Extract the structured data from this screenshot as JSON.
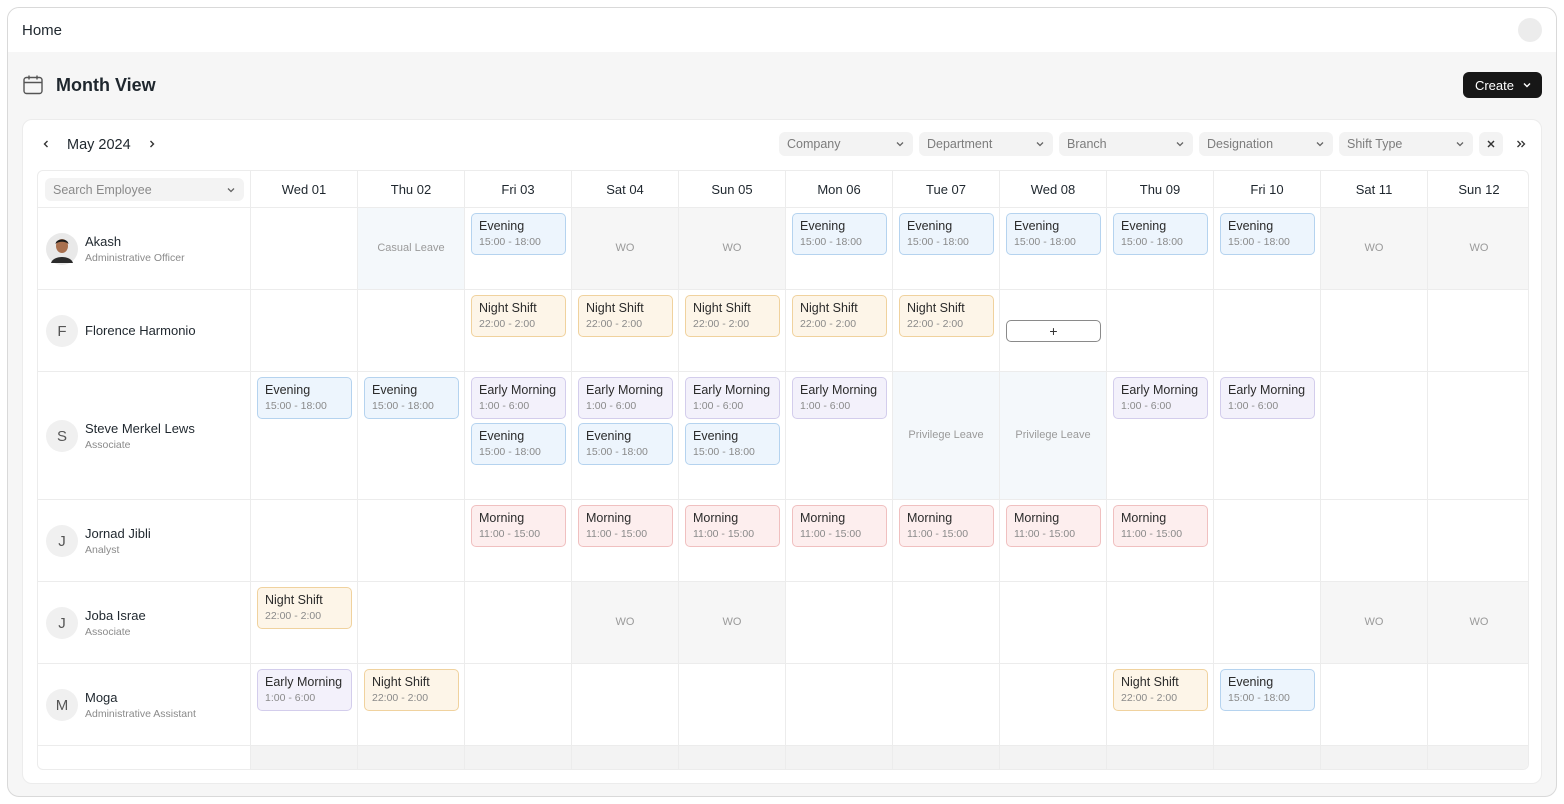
{
  "topbar": {
    "breadcrumb": "Home"
  },
  "page": {
    "title": "Month View",
    "create_label": "Create"
  },
  "toolbar": {
    "month_label": "May 2024",
    "filters": [
      "Company",
      "Department",
      "Branch",
      "Designation",
      "Shift Type"
    ]
  },
  "search": {
    "placeholder": "Search Employee"
  },
  "days": [
    "Wed 01",
    "Thu 02",
    "Fri 03",
    "Sat 04",
    "Sun 05",
    "Mon 06",
    "Tue 07",
    "Wed 08",
    "Thu 09",
    "Fri 10",
    "Sat 11",
    "Sun 12"
  ],
  "shift_types": {
    "evening": {
      "name": "Evening",
      "time": "15:00 - 18:00"
    },
    "night": {
      "name": "Night Shift",
      "time": "22:00 - 2:00"
    },
    "early": {
      "name": "Early Morning",
      "time": "1:00 - 6:00"
    },
    "morning": {
      "name": "Morning",
      "time": "11:00 - 15:00"
    }
  },
  "employees": [
    {
      "name": "Akash",
      "role": "Administrative Officer",
      "initial": "",
      "photo": true,
      "cells": [
        {},
        {
          "leave": "Casual Leave"
        },
        {
          "shifts": [
            "evening"
          ]
        },
        {
          "wo": "WO"
        },
        {
          "wo": "WO"
        },
        {
          "shifts": [
            "evening"
          ]
        },
        {
          "shifts": [
            "evening"
          ]
        },
        {
          "shifts": [
            "evening"
          ]
        },
        {
          "shifts": [
            "evening"
          ]
        },
        {
          "shifts": [
            "evening"
          ]
        },
        {
          "wo": "WO"
        },
        {
          "wo": "WO"
        }
      ]
    },
    {
      "name": "Florence Harmonio",
      "role": "",
      "initial": "F",
      "cells": [
        {},
        {},
        {
          "shifts": [
            "night"
          ]
        },
        {
          "shifts": [
            "night"
          ]
        },
        {
          "shifts": [
            "night"
          ]
        },
        {
          "shifts": [
            "night"
          ]
        },
        {
          "shifts": [
            "night"
          ]
        },
        {
          "add": "+"
        },
        {},
        {},
        {},
        {}
      ]
    },
    {
      "name": "Steve Merkel Lews",
      "role": "Associate",
      "initial": "S",
      "cells": [
        {
          "shifts": [
            "evening"
          ]
        },
        {
          "shifts": [
            "evening"
          ]
        },
        {
          "shifts": [
            "early",
            "evening"
          ]
        },
        {
          "shifts": [
            "early",
            "evening"
          ]
        },
        {
          "shifts": [
            "early",
            "evening"
          ]
        },
        {
          "shifts": [
            "early"
          ]
        },
        {
          "leave": "Privilege Leave"
        },
        {
          "leave": "Privilege Leave"
        },
        {
          "shifts": [
            "early"
          ]
        },
        {
          "shifts": [
            "early"
          ]
        },
        {},
        {}
      ]
    },
    {
      "name": "Jornad Jibli",
      "role": "Analyst",
      "initial": "J",
      "cells": [
        {},
        {},
        {
          "shifts": [
            "morning"
          ]
        },
        {
          "shifts": [
            "morning"
          ]
        },
        {
          "shifts": [
            "morning"
          ]
        },
        {
          "shifts": [
            "morning"
          ]
        },
        {
          "shifts": [
            "morning"
          ]
        },
        {
          "shifts": [
            "morning"
          ]
        },
        {
          "shifts": [
            "morning"
          ]
        },
        {},
        {},
        {}
      ]
    },
    {
      "name": "Joba Israe",
      "role": "Associate",
      "initial": "J",
      "cells": [
        {
          "shifts": [
            "night"
          ]
        },
        {},
        {},
        {
          "wo": "WO"
        },
        {
          "wo": "WO"
        },
        {},
        {},
        {},
        {},
        {},
        {
          "wo": "WO"
        },
        {
          "wo": "WO"
        }
      ]
    },
    {
      "name": "Moga",
      "role": "Administrative Assistant",
      "initial": "M",
      "cells": [
        {
          "shifts": [
            "early"
          ]
        },
        {
          "shifts": [
            "night"
          ]
        },
        {},
        {},
        {},
        {},
        {},
        {},
        {
          "shifts": [
            "night"
          ]
        },
        {
          "shifts": [
            "evening"
          ]
        },
        {},
        {}
      ]
    }
  ]
}
